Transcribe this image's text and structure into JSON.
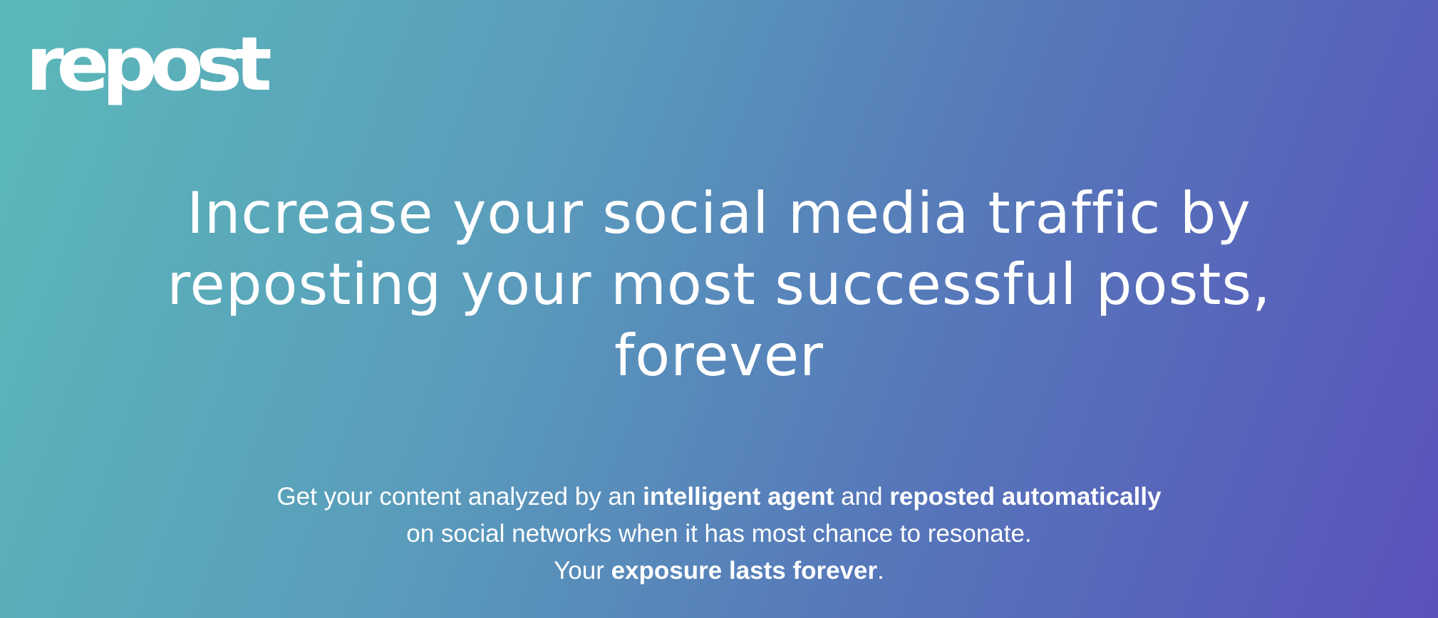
{
  "logo": {
    "text": "repost"
  },
  "headline": {
    "lines": [
      "Increase your social media traffic by",
      "reposting your most successful posts,",
      "forever"
    ]
  },
  "subtext": {
    "line1": {
      "t1": "Get your content analyzed by an ",
      "b1": "intelligent agent",
      "t2": " and ",
      "b2": "reposted automatically"
    },
    "line2": "on social networks when it has most chance to resonate.",
    "line3": {
      "t1": "Your ",
      "b1": "exposure lasts forever",
      "t2": "."
    }
  },
  "colors": {
    "gradient_start": "#5bb9ba",
    "gradient_end": "#5a52bb",
    "text": "#ffffff"
  }
}
